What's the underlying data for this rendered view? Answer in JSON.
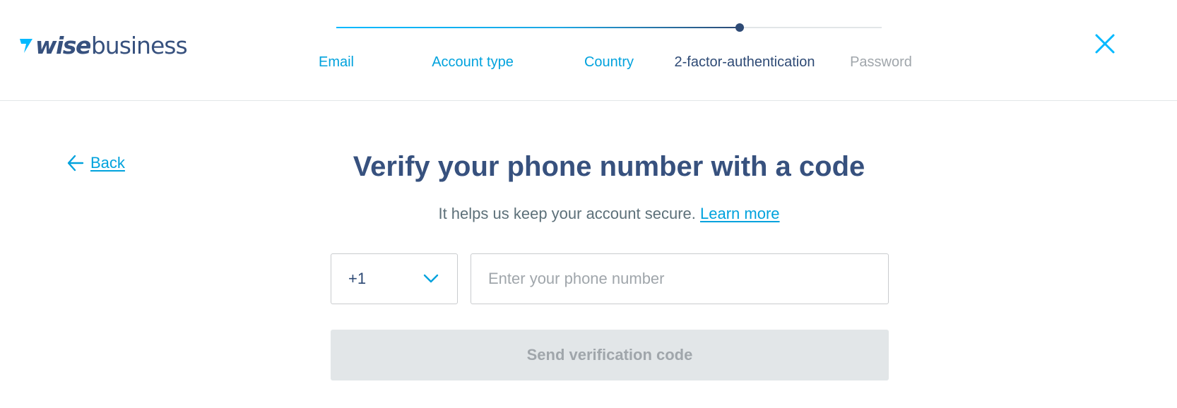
{
  "brand": {
    "wise": "wise",
    "business": "business"
  },
  "progress": {
    "fraction": 0.739
  },
  "steps": [
    {
      "label": "Email",
      "state": "done"
    },
    {
      "label": "Account type",
      "state": "done"
    },
    {
      "label": "Country",
      "state": "done"
    },
    {
      "label": "2-factor-authentication",
      "state": "current"
    },
    {
      "label": "Password",
      "state": "todo"
    }
  ],
  "icons": {
    "logo": "wise-flag-icon",
    "close": "close-icon",
    "back": "arrow-left-icon",
    "dropdown": "chevron-down-icon"
  },
  "colors": {
    "accent": "#00a2dd",
    "navy": "#37517e",
    "disabled_bg": "#e2e6e8",
    "disabled_text": "#a0a6ab"
  },
  "back": {
    "label": "Back"
  },
  "main": {
    "title": "Verify your phone number with a code",
    "subtitle": "It helps us keep your account secure.",
    "learn_more": "Learn more"
  },
  "form": {
    "country_code": "+1",
    "phone_placeholder": "Enter your phone number",
    "phone_value": "",
    "send_label": "Send verification code"
  }
}
